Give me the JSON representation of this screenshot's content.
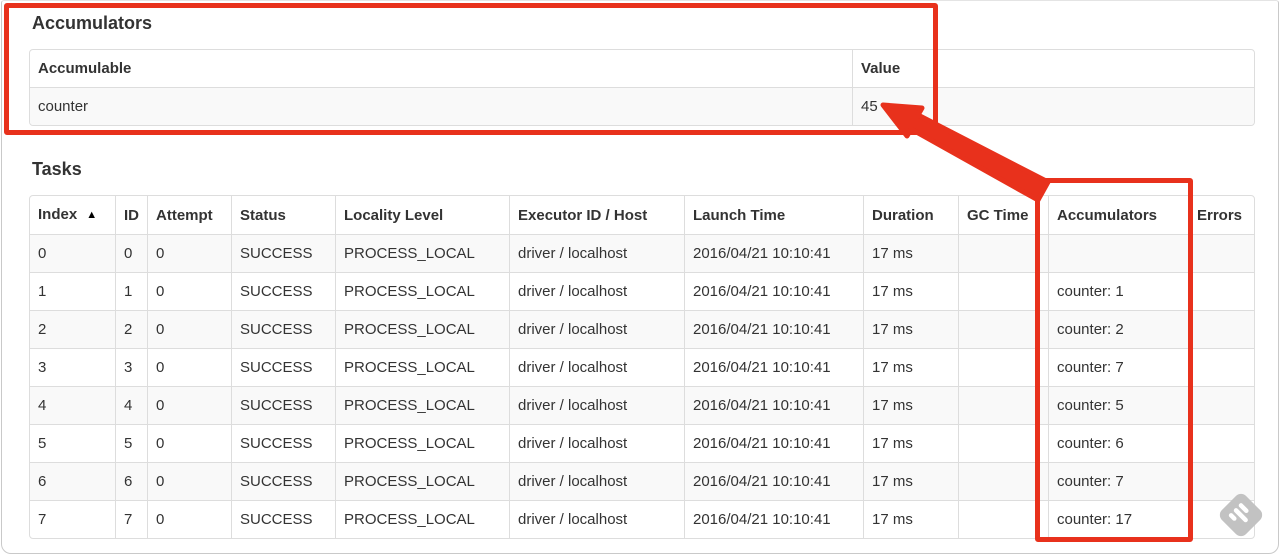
{
  "annotation": {
    "highlight_color": "#e8311c",
    "watermark_color": "#c2c2c2"
  },
  "accumulators_section": {
    "heading": "Accumulators",
    "table": {
      "headers": [
        "Accumulable",
        "Value"
      ],
      "rows": [
        [
          "counter",
          "45"
        ]
      ]
    }
  },
  "tasks_section": {
    "heading": "Tasks",
    "table": {
      "headers": [
        "Index",
        "ID",
        "Attempt",
        "Status",
        "Locality Level",
        "Executor ID / Host",
        "Launch Time",
        "Duration",
        "GC Time",
        "Accumulators",
        "Errors"
      ],
      "sorted_header": "Index",
      "sort_indicator": "▲",
      "rows": [
        [
          "0",
          "0",
          "0",
          "SUCCESS",
          "PROCESS_LOCAL",
          "driver / localhost",
          "2016/04/21 10:10:41",
          "17 ms",
          "",
          "",
          ""
        ],
        [
          "1",
          "1",
          "0",
          "SUCCESS",
          "PROCESS_LOCAL",
          "driver / localhost",
          "2016/04/21 10:10:41",
          "17 ms",
          "",
          "counter: 1",
          ""
        ],
        [
          "2",
          "2",
          "0",
          "SUCCESS",
          "PROCESS_LOCAL",
          "driver / localhost",
          "2016/04/21 10:10:41",
          "17 ms",
          "",
          "counter: 2",
          ""
        ],
        [
          "3",
          "3",
          "0",
          "SUCCESS",
          "PROCESS_LOCAL",
          "driver / localhost",
          "2016/04/21 10:10:41",
          "17 ms",
          "",
          "counter: 7",
          ""
        ],
        [
          "4",
          "4",
          "0",
          "SUCCESS",
          "PROCESS_LOCAL",
          "driver / localhost",
          "2016/04/21 10:10:41",
          "17 ms",
          "",
          "counter: 5",
          ""
        ],
        [
          "5",
          "5",
          "0",
          "SUCCESS",
          "PROCESS_LOCAL",
          "driver / localhost",
          "2016/04/21 10:10:41",
          "17 ms",
          "",
          "counter: 6",
          ""
        ],
        [
          "6",
          "6",
          "0",
          "SUCCESS",
          "PROCESS_LOCAL",
          "driver / localhost",
          "2016/04/21 10:10:41",
          "17 ms",
          "",
          "counter: 7",
          ""
        ],
        [
          "7",
          "7",
          "0",
          "SUCCESS",
          "PROCESS_LOCAL",
          "driver / localhost",
          "2016/04/21 10:10:41",
          "17 ms",
          "",
          "counter: 17",
          ""
        ]
      ]
    }
  }
}
